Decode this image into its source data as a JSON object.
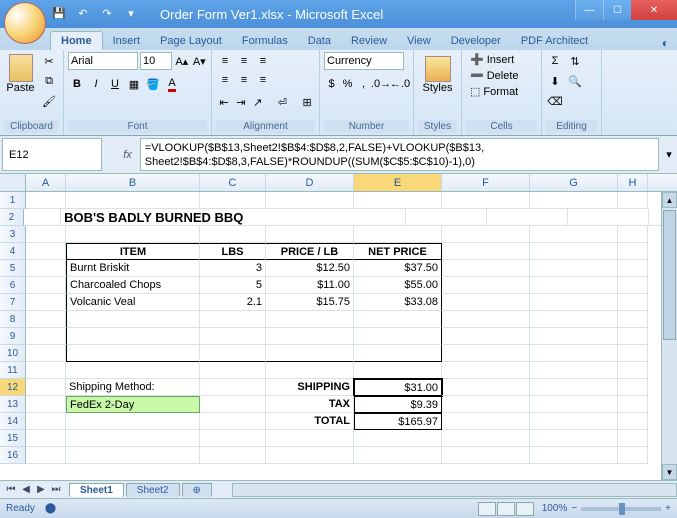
{
  "window": {
    "title": "Order Form Ver1.xlsx - Microsoft Excel"
  },
  "ribbon": {
    "tabs": [
      "Home",
      "Insert",
      "Page Layout",
      "Formulas",
      "Data",
      "Review",
      "View",
      "Developer",
      "PDF Architect"
    ],
    "activeTab": "Home",
    "groups": {
      "clipboard": "Clipboard",
      "font": "Font",
      "alignment": "Alignment",
      "number": "Number",
      "styles": "Styles",
      "cells": "Cells",
      "editing": "Editing"
    },
    "paste": "Paste",
    "fontName": "Arial",
    "fontSize": "10",
    "numberFormat": "Currency",
    "stylesLabel": "Styles",
    "insert": "Insert",
    "delete": "Delete",
    "format": "Format"
  },
  "formulaBar": {
    "nameBox": "E12",
    "formula": "=VLOOKUP($B$13,Sheet2!$B$4:$D$8,2,FALSE)+VLOOKUP($B$13,\nSheet2!$B$4:$D$8,3,FALSE)*ROUNDUP((SUM($C$5:$C$10)-1),0)"
  },
  "columns": [
    "A",
    "B",
    "C",
    "D",
    "E",
    "F",
    "G",
    "H"
  ],
  "sheet": {
    "title": "BOB'S BADLY BURNED BBQ",
    "headers": {
      "item": "ITEM",
      "lbs": "LBS",
      "pricePerLb": "PRICE / LB",
      "netPrice": "NET PRICE"
    },
    "rows": [
      {
        "item": "Burnt Briskit",
        "lbs": "3",
        "price": "$12.50",
        "net": "$37.50"
      },
      {
        "item": "Charcoaled Chops",
        "lbs": "5",
        "price": "$11.00",
        "net": "$55.00"
      },
      {
        "item": "Volcanic Veal",
        "lbs": "2.1",
        "price": "$15.75",
        "net": "$33.08"
      },
      {
        "item": "",
        "lbs": "",
        "price": "",
        "net": ""
      },
      {
        "item": "",
        "lbs": "",
        "price": "",
        "net": ""
      },
      {
        "item": "",
        "lbs": "",
        "price": "",
        "net": ""
      }
    ],
    "shippingMethodLabel": "Shipping Method:",
    "shippingMethod": "FedEx 2-Day",
    "summary": {
      "shippingLabel": "SHIPPING",
      "shipping": "$31.00",
      "taxLabel": "TAX",
      "tax": "$9.39",
      "totalLabel": "TOTAL",
      "total": "$165.97"
    }
  },
  "sheetTabs": [
    "Sheet1",
    "Sheet2"
  ],
  "activeSheet": "Sheet1",
  "status": {
    "ready": "Ready",
    "zoom": "100%"
  }
}
